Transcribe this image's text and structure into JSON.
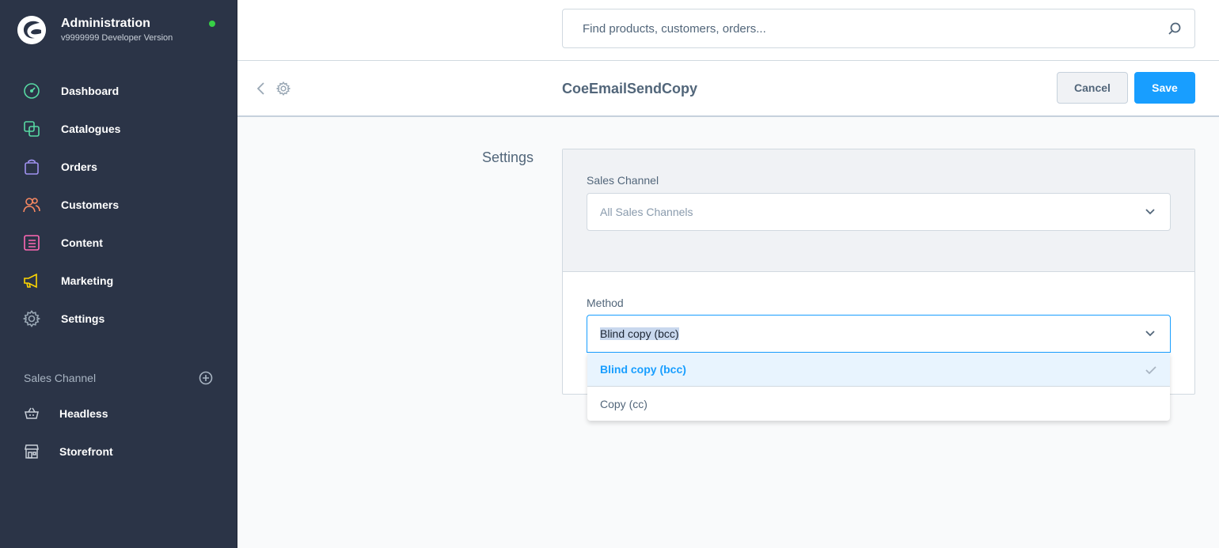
{
  "app": {
    "title": "Administration",
    "version": "v9999999 Developer Version",
    "status_color": "#37d046"
  },
  "sidebar": {
    "items": [
      {
        "label": "Dashboard",
        "icon": "dashboard-gauge-icon",
        "color": "#57d9a3"
      },
      {
        "label": "Catalogues",
        "icon": "catalogues-icon",
        "color": "#57d9a3"
      },
      {
        "label": "Orders",
        "icon": "orders-bag-icon",
        "color": "#a092f0"
      },
      {
        "label": "Customers",
        "icon": "customers-icon",
        "color": "#f88962"
      },
      {
        "label": "Content",
        "icon": "content-icon",
        "color": "#ff68b4"
      },
      {
        "label": "Marketing",
        "icon": "marketing-megaphone-icon",
        "color": "#ffd700"
      },
      {
        "label": "Settings",
        "icon": "settings-gear-icon",
        "color": "#9aa8b5"
      }
    ],
    "sales_channel": {
      "title": "Sales Channel",
      "items": [
        {
          "label": "Headless",
          "icon": "basket-icon"
        },
        {
          "label": "Storefront",
          "icon": "storefront-icon"
        }
      ]
    }
  },
  "search": {
    "placeholder": "Find products, customers, orders..."
  },
  "smartbar": {
    "title": "CoeEmailSendCopy",
    "cancel_label": "Cancel",
    "save_label": "Save"
  },
  "content": {
    "section_label": "Settings",
    "sales_channel_field": {
      "label": "Sales Channel",
      "value": "All Sales Channels"
    },
    "method_field": {
      "label": "Method",
      "value": "Blind copy (bcc)",
      "options": [
        "Blind copy (bcc)",
        "Copy (cc)"
      ]
    }
  },
  "colors": {
    "accent": "#189eff",
    "sidebar_bg": "#2b3447"
  }
}
